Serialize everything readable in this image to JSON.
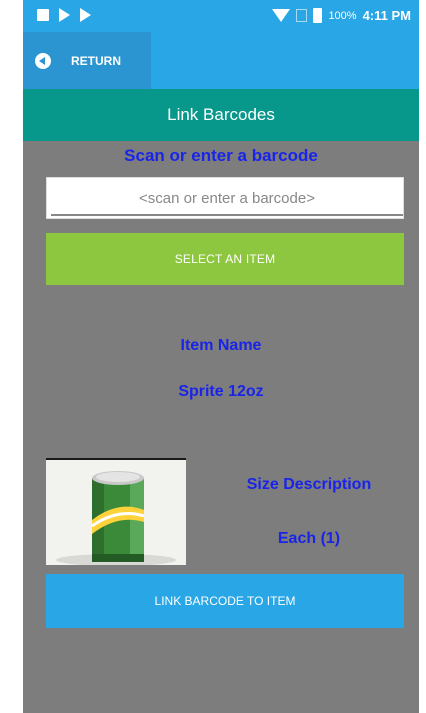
{
  "status_bar": {
    "battery_pct": "100%",
    "time": "4:11 PM"
  },
  "toolbar": {
    "return_label": "RETURN"
  },
  "screen": {
    "title": "Link Barcodes",
    "scan_heading": "Scan or enter a barcode",
    "barcode_placeholder": "<scan or enter a barcode>",
    "barcode_value": "",
    "select_button_label": "SELECT AN ITEM",
    "item_name_label": "Item Name",
    "item_name_value": "Sprite 12oz",
    "size_label": "Size Description",
    "size_value": "Each (1)",
    "link_button_label": "LINK BARCODE TO ITEM"
  },
  "colors": {
    "status_blue": "#29a6e6",
    "teal": "#08978b",
    "green": "#8dc63f",
    "text_blue": "#1a24e8",
    "background_gray": "#7d7d7d"
  },
  "icons": [
    "image-icon",
    "play-icon",
    "play-icon",
    "wifi-icon",
    "sim-icon",
    "battery-icon",
    "return-arrow-icon"
  ]
}
